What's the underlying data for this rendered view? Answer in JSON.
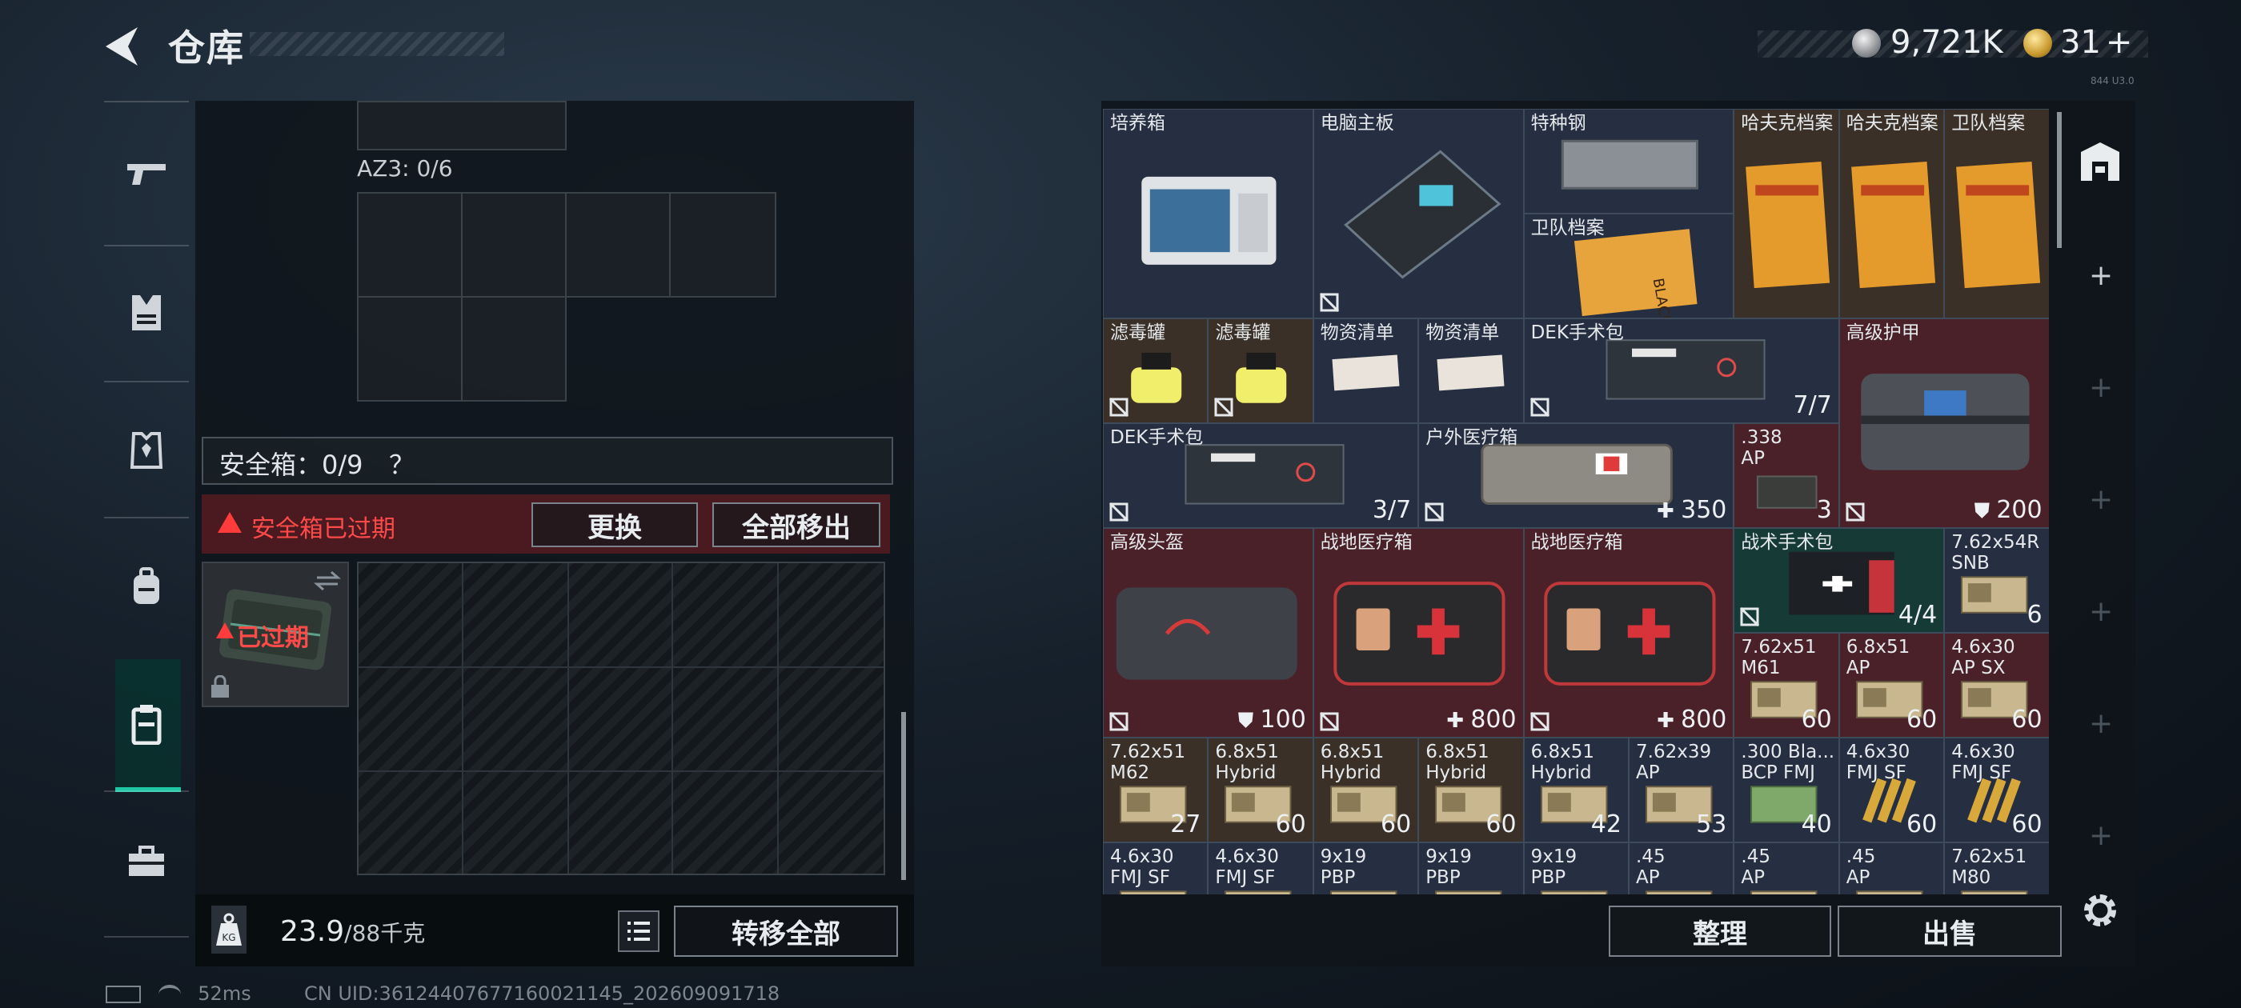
{
  "header": {
    "title": "仓库",
    "coins": "9,721K",
    "gold": "31",
    "gold_add": "+",
    "version": "844 U3.0"
  },
  "colors": {
    "accent": "#1fc6a3",
    "warning": "#ff3b3b",
    "expired_bg": "#4a1a20"
  },
  "sidebar": {
    "items": [
      {
        "icon": "gun-icon"
      },
      {
        "icon": "vest-icon"
      },
      {
        "icon": "armor-icon"
      },
      {
        "icon": "backpack-icon"
      },
      {
        "icon": "safe-case-icon"
      },
      {
        "icon": "toolbox-icon"
      }
    ],
    "active_index": 4
  },
  "left": {
    "az3_label": "AZ3: 0/6",
    "safe_label": "安全箱：0/9",
    "safe_help": "？",
    "expired_text": "安全箱已过期",
    "swap_label": "更换",
    "move_all_label": "全部移出",
    "case_expired": "已过期",
    "weight_value": "23.9",
    "weight_max": "/88千克",
    "transfer_label": "转移全部"
  },
  "status": {
    "ping": "52ms",
    "uid": "CN UID:36124407677160021145_202609091718"
  },
  "right": {
    "items": [
      {
        "name": "培养箱",
        "count": "",
        "bg": "n"
      },
      {
        "name": "电脑主板",
        "count": "",
        "bg": "n"
      },
      {
        "name": "特种钢",
        "count": "",
        "bg": "n"
      },
      {
        "name": "卫队档案",
        "count": "",
        "bg": "n"
      },
      {
        "name": "哈夫克档案",
        "count": "",
        "bg": "b"
      },
      {
        "name": "哈夫克档案",
        "count": "",
        "bg": "b"
      },
      {
        "name": "卫队档案",
        "count": "",
        "bg": "b"
      },
      {
        "name": "滤毒罐",
        "count": "",
        "bg": "b"
      },
      {
        "name": "滤毒罐",
        "count": "",
        "bg": "b"
      },
      {
        "name": "物资清单",
        "count": "",
        "bg": "n"
      },
      {
        "name": "物资清单",
        "count": "",
        "bg": "n"
      },
      {
        "name": "DEK手术包",
        "count": "7/7",
        "bg": "n"
      },
      {
        "name": "高级护甲",
        "count": "200",
        "bg": "r"
      },
      {
        "name": "DEK手术包",
        "count": "3/7",
        "bg": "n"
      },
      {
        "name": "户外医疗箱",
        "count": "350",
        "bg": "n"
      },
      {
        "name": ".338\nAP",
        "count": "3",
        "bg": "r"
      },
      {
        "name": "高级头盔",
        "count": "100",
        "bg": "r"
      },
      {
        "name": "战地医疗箱",
        "count": "800",
        "bg": "r"
      },
      {
        "name": "战地医疗箱",
        "count": "800",
        "bg": "r"
      },
      {
        "name": "战术手术包",
        "count": "4/4",
        "bg": "g"
      },
      {
        "name": "7.62x54R\nSNB",
        "count": "6",
        "bg": "n"
      },
      {
        "name": "7.62x51\nM61",
        "count": "60",
        "bg": "r"
      },
      {
        "name": "6.8x51\nAP",
        "count": "60",
        "bg": "r"
      },
      {
        "name": "4.6x30\nAP SX",
        "count": "60",
        "bg": "r"
      },
      {
        "name": "7.62x51\nM62",
        "count": "27",
        "bg": "b"
      },
      {
        "name": "6.8x51\nHybrid",
        "count": "60",
        "bg": "b"
      },
      {
        "name": "6.8x51\nHybrid",
        "count": "60",
        "bg": "b"
      },
      {
        "name": "6.8x51\nHybrid",
        "count": "60",
        "bg": "b"
      },
      {
        "name": "6.8x51\nHybrid",
        "count": "42",
        "bg": "n"
      },
      {
        "name": "7.62x39\nAP",
        "count": "53",
        "bg": "n"
      },
      {
        "name": ".300 Bla...\nBCP FMJ",
        "count": "40",
        "bg": "n"
      },
      {
        "name": "4.6x30\nFMJ SF",
        "count": "60",
        "bg": "n"
      },
      {
        "name": "4.6x30\nFMJ SF",
        "count": "60",
        "bg": "n"
      },
      {
        "name": "4.6x30\nFMJ SF",
        "count": "",
        "bg": "n"
      },
      {
        "name": "4.6x30\nFMJ SF",
        "count": "",
        "bg": "n"
      },
      {
        "name": "9x19\nPBP",
        "count": "",
        "bg": "n"
      },
      {
        "name": "9x19\nPBP",
        "count": "",
        "bg": "n"
      },
      {
        "name": "9x19\nPBP",
        "count": "",
        "bg": "n"
      },
      {
        "name": ".45\nAP",
        "count": "",
        "bg": "n"
      },
      {
        "name": ".45\nAP",
        "count": "",
        "bg": "n"
      },
      {
        "name": ".45\nAP",
        "count": "",
        "bg": "n"
      },
      {
        "name": "7.62x51\nM80",
        "count": "",
        "bg": "n"
      }
    ],
    "sort_label": "整理",
    "sell_label": "出售"
  }
}
